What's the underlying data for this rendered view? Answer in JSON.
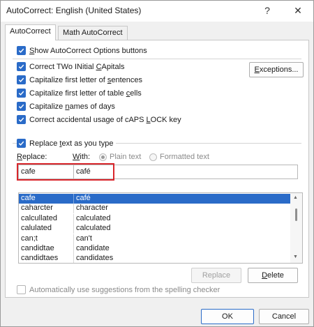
{
  "window": {
    "title": "AutoCorrect: English (United States)",
    "help_glyph": "?",
    "close_glyph": "✕"
  },
  "tabs": [
    {
      "label": "AutoCorrect",
      "active": true
    },
    {
      "label": "Math AutoCorrect",
      "active": false
    }
  ],
  "options": {
    "show_buttons": {
      "pre": "",
      "u": "S",
      "post": "how AutoCorrect Options buttons",
      "checked": true
    },
    "two_initials": {
      "pre": "Correct TWo INitial ",
      "u": "C",
      "post": "Apitals",
      "checked": true
    },
    "first_letter_sentences": {
      "pre": "Capitalize first letter of ",
      "u": "s",
      "post": "entences",
      "checked": true
    },
    "first_letter_table": {
      "pre": "Capitalize first letter of table ",
      "u": "c",
      "post": "ells",
      "checked": true
    },
    "names_of_days": {
      "pre": "Capitalize ",
      "u": "n",
      "post": "ames of days",
      "checked": true
    },
    "caps_lock": {
      "pre": "Correct accidental usage of cAPS ",
      "u": "L",
      "post": "OCK key",
      "checked": true
    },
    "replace_as_type": {
      "pre": "Replace ",
      "u": "t",
      "post": "ext as you type",
      "checked": true
    },
    "auto_suggestions": {
      "label": "Automatically use suggestions from the spelling checker",
      "checked": false
    }
  },
  "exceptions_button": {
    "u": "E",
    "post": "xceptions..."
  },
  "replace_label": {
    "u": "R",
    "post": "eplace:"
  },
  "with_label": {
    "u": "W",
    "post": "ith:"
  },
  "radios": {
    "plain_text": "Plain text",
    "formatted_text": "Formatted text"
  },
  "replace_value": "cafe",
  "with_value": "café",
  "entries": [
    {
      "replace": "cafe",
      "with": "café",
      "selected": true
    },
    {
      "replace": "caharcter",
      "with": "character",
      "selected": false
    },
    {
      "replace": "calcullated",
      "with": "calculated",
      "selected": false
    },
    {
      "replace": "calulated",
      "with": "calculated",
      "selected": false
    },
    {
      "replace": "can;t",
      "with": "can't",
      "selected": false
    },
    {
      "replace": "candidtae",
      "with": "candidate",
      "selected": false
    },
    {
      "replace": "candidtaes",
      "with": "candidates",
      "selected": false
    }
  ],
  "buttons": {
    "replace": "Replace",
    "delete": {
      "u": "D",
      "post": "elete"
    },
    "ok": "OK",
    "cancel": "Cancel"
  }
}
